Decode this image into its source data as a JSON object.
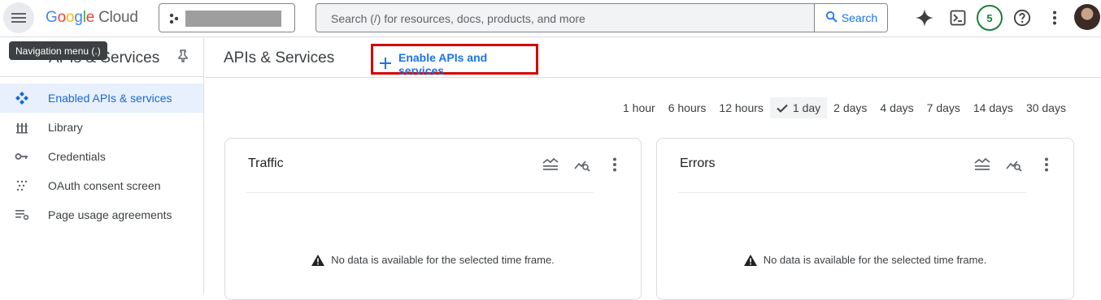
{
  "topbar": {
    "logo_google": "Google",
    "logo_cloud": "Cloud",
    "search_placeholder": "Search (/) for resources, docs, products, and more",
    "search_button": "Search",
    "notification_count": "5"
  },
  "tooltip": "Navigation menu (.)",
  "sidebar": {
    "title": "APIs & Services",
    "items": [
      {
        "label": "Enabled APIs & services",
        "icon": "api-icon",
        "active": true
      },
      {
        "label": "Library",
        "icon": "library-icon",
        "active": false
      },
      {
        "label": "Credentials",
        "icon": "key-icon",
        "active": false
      },
      {
        "label": "OAuth consent screen",
        "icon": "consent-icon",
        "active": false
      },
      {
        "label": "Page usage agreements",
        "icon": "settings-list-icon",
        "active": false
      }
    ]
  },
  "main": {
    "title": "APIs & Services",
    "enable_button": "Enable APIs and services",
    "time_options": [
      "1 hour",
      "6 hours",
      "12 hours",
      "1 day",
      "2 days",
      "4 days",
      "7 days",
      "14 days",
      "30 days"
    ],
    "selected_time": "1 day",
    "cards": [
      {
        "title": "Traffic",
        "message": "No data is available for the selected time frame."
      },
      {
        "title": "Errors",
        "message": "No data is available for the selected time frame."
      }
    ]
  },
  "colors": {
    "accent": "#1a73e8",
    "highlight_box": "#d50000",
    "active_bg": "#e8f0fe",
    "badge": "#188038"
  }
}
